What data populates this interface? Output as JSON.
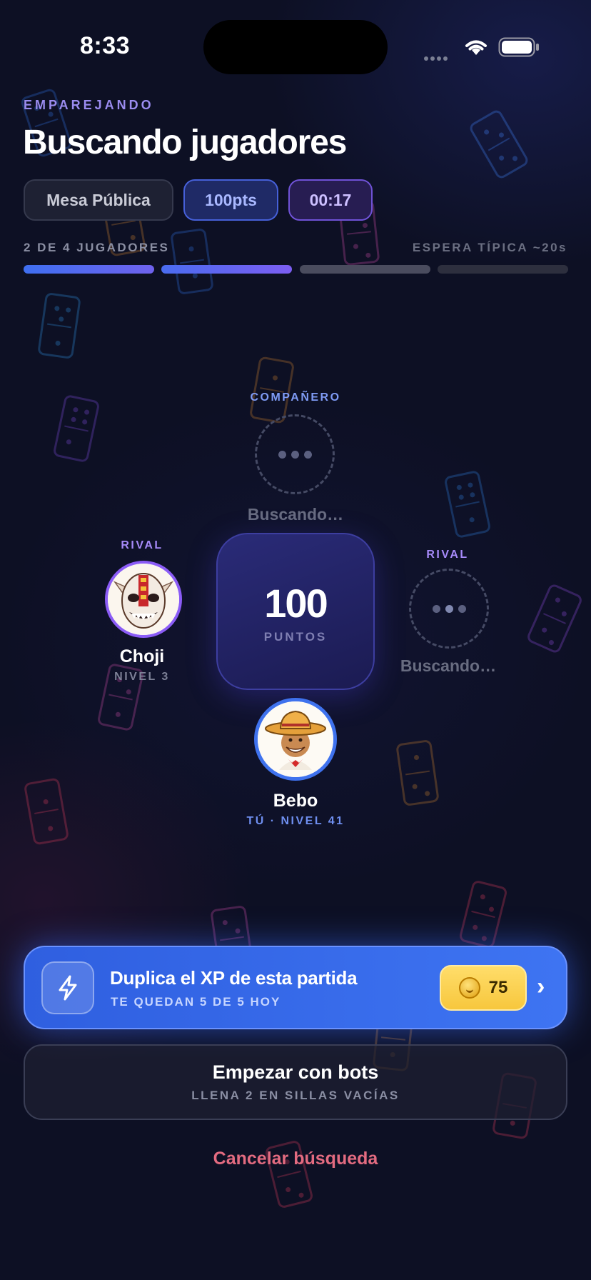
{
  "status_bar": {
    "time": "8:33"
  },
  "header": {
    "eyebrow": "EMPAREJANDO",
    "title": "Buscando jugadores",
    "chips": {
      "table": "Mesa Pública",
      "points": "100pts",
      "timer": "00:17"
    }
  },
  "progress": {
    "players_label": "2 DE 4 JUGADORES",
    "typical_wait": "ESPERA TÍPICA ~20s",
    "filled_segments": 2,
    "total_segments": 4
  },
  "seats": {
    "top": {
      "role": "COMPAÑERO",
      "status": "Buscando…"
    },
    "left": {
      "role": "RIVAL",
      "name": "Choji",
      "level": "NIVEL 3"
    },
    "right": {
      "role": "RIVAL",
      "status": "Buscando…"
    },
    "bottom": {
      "name": "Bebo",
      "level": "TÚ · NIVEL 41"
    }
  },
  "center": {
    "value": "100",
    "label": "PUNTOS"
  },
  "xp_offer": {
    "title": "Duplica el XP de esta partida",
    "subtitle": "TE QUEDAN 5 DE 5 HOY",
    "cost": "75",
    "icon": "lightning-icon"
  },
  "bots_button": {
    "title": "Empezar con bots",
    "subtitle": "LLENA 2 EN SILLAS VACÍAS"
  },
  "cancel": "Cancelar búsqueda",
  "colors": {
    "background": "#0d1024",
    "accent_blue": "#3e74f2",
    "accent_purple": "#a78bfa",
    "coin_gold": "#f7c73d",
    "cancel_red": "#e36b80"
  }
}
